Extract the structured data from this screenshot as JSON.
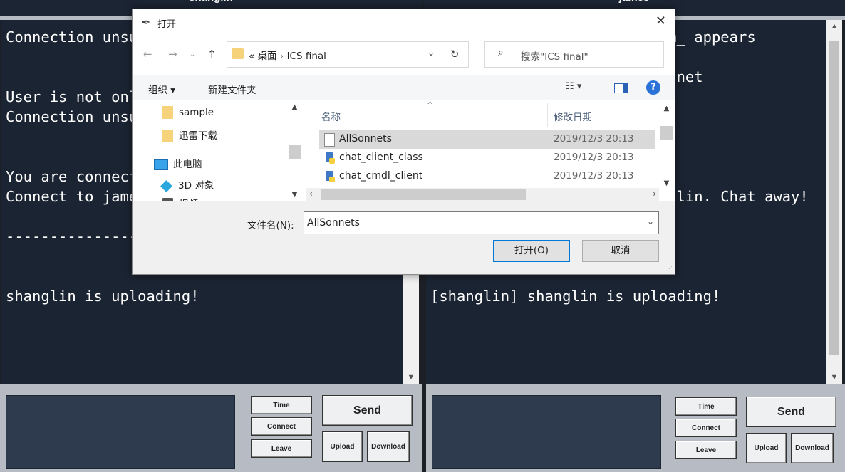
{
  "left_window": {
    "title": "shanglin",
    "chat_text": "Connection unsuccessful\n\n\nUser is not online, try again later\nConnection unsuccessful\n\n\nYou are connected with james\nConnect to james. Chat away!\n\n---------------------------------------------------------\n\n\nshanglin is uploading!",
    "buttons": {
      "time": "Time",
      "connect": "Connect",
      "leave": "Leave",
      "send": "Send",
      "upload": "Upload",
      "download": "Download"
    }
  },
  "right_window": {
    "title": "james",
    "chat_text": "Search chat logs where _term_ appears\n\nSonnet number ___ to get sonnet\nonnet\n\n\n\n\nYou are connected with shanglin. Chat away!\n\n\n\n\n[shanglin] shanglin is uploading!",
    "buttons": {
      "time": "Time",
      "connect": "Connect",
      "leave": "Leave",
      "send": "Send",
      "upload": "Upload",
      "download": "Download"
    }
  },
  "dialog": {
    "title": "打开",
    "address": {
      "prefix": "«",
      "part1": "桌面",
      "sep": "›",
      "part2": "ICS final"
    },
    "search_placeholder": "搜索\"ICS final\"",
    "organize": "组织 ▾",
    "new_folder": "新建文件夹",
    "nav_items": [
      "sample",
      "迅雷下载",
      "此电脑",
      "3D 对象",
      "视频"
    ],
    "columns": {
      "name": "名称",
      "date": "修改日期"
    },
    "files": [
      {
        "name": "AllSonnets",
        "date": "2019/12/3 20:13",
        "type": "text"
      },
      {
        "name": "chat_client_class",
        "date": "2019/12/3 20:13",
        "type": "python"
      },
      {
        "name": "chat_cmdl_client",
        "date": "2019/12/3 20:13",
        "type": "python"
      }
    ],
    "filename_label": "文件名(N):",
    "filename_value": "AllSonnets",
    "open_button": "打开(O)",
    "cancel_button": "取消"
  }
}
